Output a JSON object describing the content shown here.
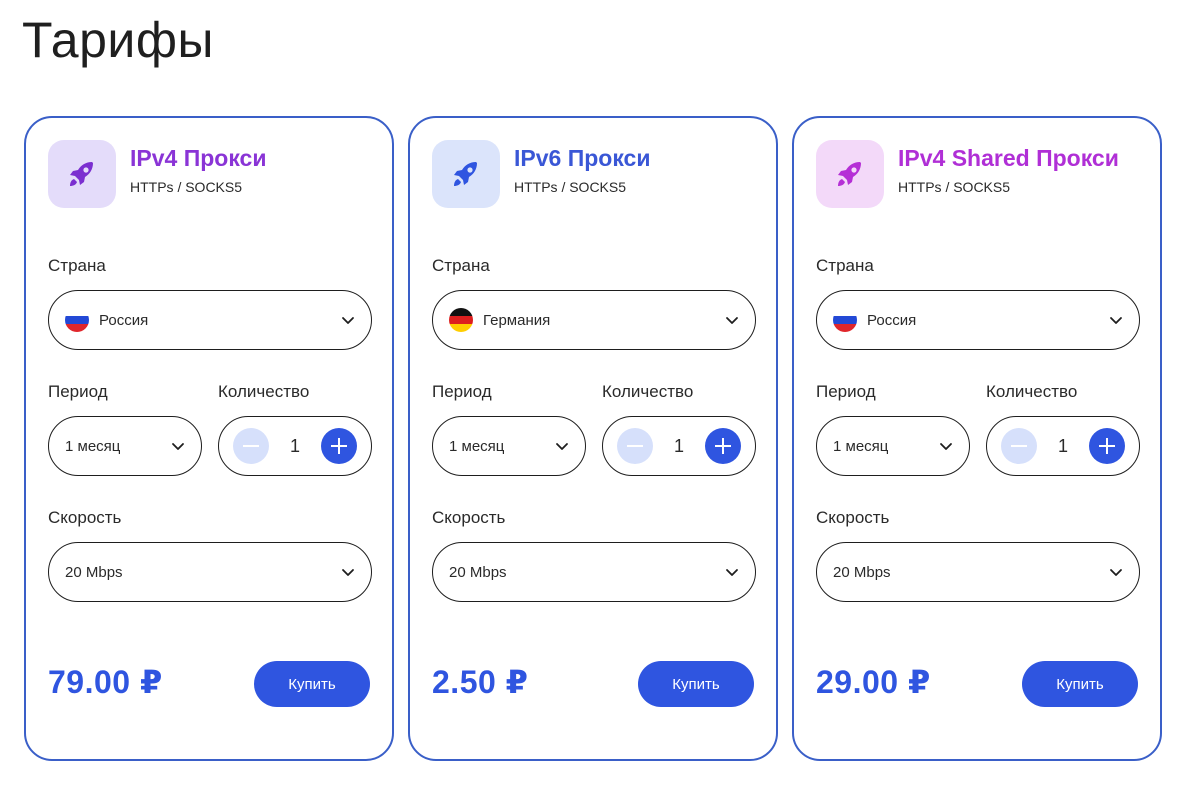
{
  "page": {
    "title": "Тарифы"
  },
  "labels": {
    "country": "Страна",
    "period": "Период",
    "quantity": "Количество",
    "speed": "Скорость"
  },
  "cards": [
    {
      "title": "IPv4 Прокси",
      "subtitle": "HTTPs / SOCKS5",
      "title_color": "#8a34d6",
      "icon": "rocket-icon",
      "icon_bg": "#e4dcfa",
      "icon_color": "#7b2fd0",
      "country": "Россия",
      "country_flag": "russia-flag",
      "period": "1 месяц",
      "quantity": "1",
      "speed": "20 Mbps",
      "price": "79.00 ₽",
      "buy_label": "Купить"
    },
    {
      "title": "IPv6 Прокси",
      "subtitle": "HTTPs / SOCKS5",
      "title_color": "#3a57d6",
      "icon": "rocket-icon",
      "icon_bg": "#dbe4fb",
      "icon_color": "#2f55e0",
      "country": "Германия",
      "country_flag": "germany-flag",
      "period": "1 месяц",
      "quantity": "1",
      "speed": "20 Mbps",
      "price": "2.50 ₽",
      "buy_label": "Купить"
    },
    {
      "title": "IPv4 Shared Прокси",
      "subtitle": "HTTPs / SOCKS5",
      "title_color": "#b02fd6",
      "icon": "rocket-icon",
      "icon_bg": "#f3d9f9",
      "icon_color": "#b52fd6",
      "country": "Россия",
      "country_flag": "russia-flag",
      "period": "1 месяц",
      "quantity": "1",
      "speed": "20 Mbps",
      "price": "29.00 ₽",
      "buy_label": "Купить"
    }
  ],
  "colors": {
    "accent": "#2f55e0",
    "card_border": "#3a5fc8",
    "stepper_minus_bg": "#d6e0fb"
  }
}
